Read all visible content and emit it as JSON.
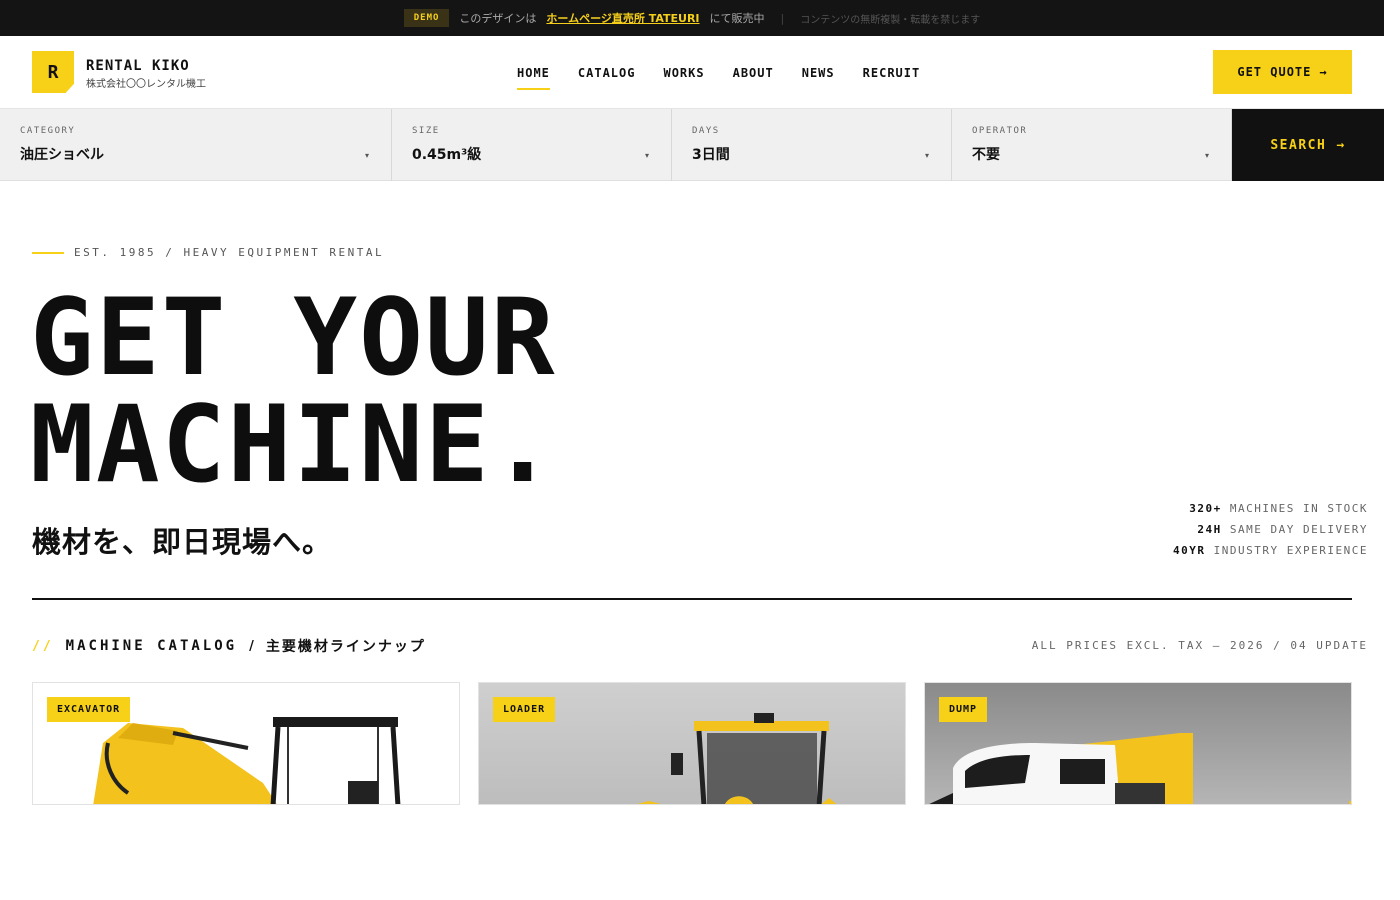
{
  "demo_bar": {
    "badge": "DEMO",
    "text_before": "このデザインは",
    "link": "ホームページ直売所 TATEURI",
    "text_after": "にて販売中",
    "note": "コンテンツの無断複製・転載を禁じます"
  },
  "header": {
    "logo_letter": "R",
    "brand": "RENTAL KIKO",
    "company": "株式会社〇〇レンタル機工",
    "nav": [
      {
        "label": "HOME"
      },
      {
        "label": "CATALOG"
      },
      {
        "label": "WORKS"
      },
      {
        "label": "ABOUT"
      },
      {
        "label": "NEWS"
      },
      {
        "label": "RECRUIT"
      }
    ],
    "quote_label": "GET QUOTE",
    "quote_arrow": "→"
  },
  "search": {
    "fields": [
      {
        "label": "CATEGORY",
        "value": "油圧ショベル"
      },
      {
        "label": "SIZE",
        "value": "0.45m³級"
      },
      {
        "label": "DAYS",
        "value": "3日間"
      },
      {
        "label": "OPERATOR",
        "value": "不要"
      }
    ],
    "caret": "▾",
    "button_label": "SEARCH",
    "button_arrow": "→"
  },
  "hero": {
    "eyebrow": "EST. 1985 / HEAVY EQUIPMENT RENTAL",
    "line1": "GET YOUR",
    "line2": "MACHINE.",
    "tagline": "機材を、即日現場へ。",
    "stats": [
      {
        "value": "320+",
        "label": "MACHINES IN STOCK"
      },
      {
        "value": "24H",
        "label": "SAME DAY DELIVERY"
      },
      {
        "value": "40YR",
        "label": "INDUSTRY EXPERIENCE"
      }
    ]
  },
  "catalog": {
    "slash": "//",
    "title": "MACHINE CATALOG",
    "separator": "/",
    "title_jp": "主要機材ラインナップ",
    "note": "ALL PRICES EXCL. TAX — 2026 / 04 UPDATE",
    "cards": [
      {
        "tag": "EXCAVATOR"
      },
      {
        "tag": "LOADER"
      },
      {
        "tag": "DUMP"
      }
    ]
  },
  "colors": {
    "accent": "#f7d117",
    "dark": "#111111",
    "bar_bg": "#f0f0f0"
  }
}
